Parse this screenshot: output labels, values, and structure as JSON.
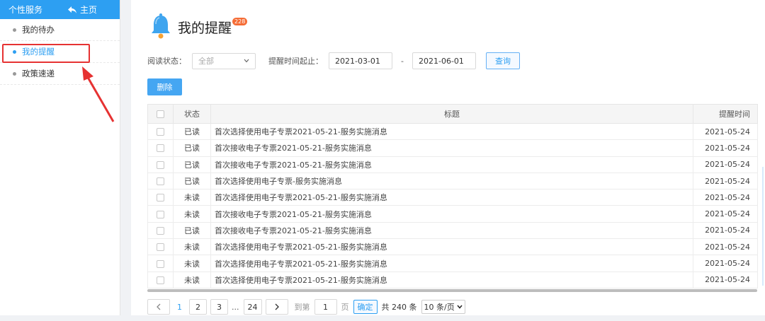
{
  "sidebar": {
    "title": "个性服务",
    "home_label": "主页",
    "items": [
      {
        "label": "我的待办",
        "active": false
      },
      {
        "label": "我的提醒",
        "active": true
      },
      {
        "label": "政策速递",
        "active": false
      }
    ]
  },
  "header": {
    "title": "我的提醒",
    "badge": "228"
  },
  "filters": {
    "read_status_label": "阅读状态：",
    "read_status_value": "全部",
    "time_range_label": "提醒时间起止：",
    "start_date": "2021-03-01",
    "range_sep": "-",
    "end_date": "2021-06-01",
    "query_label": "查询"
  },
  "actions": {
    "delete_label": "删除"
  },
  "table": {
    "columns": {
      "status": "状态",
      "title": "标题",
      "time": "提醒时间"
    },
    "rows": [
      {
        "status": "已读",
        "title": "首次选择使用电子专票2021-05-21-服务实施消息",
        "time": "2021-05-24"
      },
      {
        "status": "已读",
        "title": "首次接收电子专票2021-05-21-服务实施消息",
        "time": "2021-05-24"
      },
      {
        "status": "已读",
        "title": "首次接收电子专票2021-05-21-服务实施消息",
        "time": "2021-05-24"
      },
      {
        "status": "已读",
        "title": "首次选择使用电子专票-服务实施消息",
        "time": "2021-05-24"
      },
      {
        "status": "未读",
        "title": "首次选择使用电子专票2021-05-21-服务实施消息",
        "time": "2021-05-24"
      },
      {
        "status": "未读",
        "title": "首次接收电子专票2021-05-21-服务实施消息",
        "time": "2021-05-24"
      },
      {
        "status": "已读",
        "title": "首次接收电子专票2021-05-21-服务实施消息",
        "time": "2021-05-24"
      },
      {
        "status": "未读",
        "title": "首次选择使用电子专票2021-05-21-服务实施消息",
        "time": "2021-05-24"
      },
      {
        "status": "未读",
        "title": "首次选择使用电子专票2021-05-21-服务实施消息",
        "time": "2021-05-24"
      },
      {
        "status": "未读",
        "title": "首次选择使用电子专票2021-05-21-服务实施消息",
        "time": "2021-05-24"
      }
    ]
  },
  "pagination": {
    "pages": [
      "1",
      "2",
      "3"
    ],
    "ellipsis": "...",
    "last_page": "24",
    "goto_label": "到第",
    "goto_value": "1",
    "page_unit": "页",
    "confirm_label": "确定",
    "total_label": "共 240 条",
    "page_size": "10 条/页"
  },
  "colors": {
    "accent": "#2d9ff2",
    "highlight": "#e63232",
    "badge": "#f56c35"
  }
}
